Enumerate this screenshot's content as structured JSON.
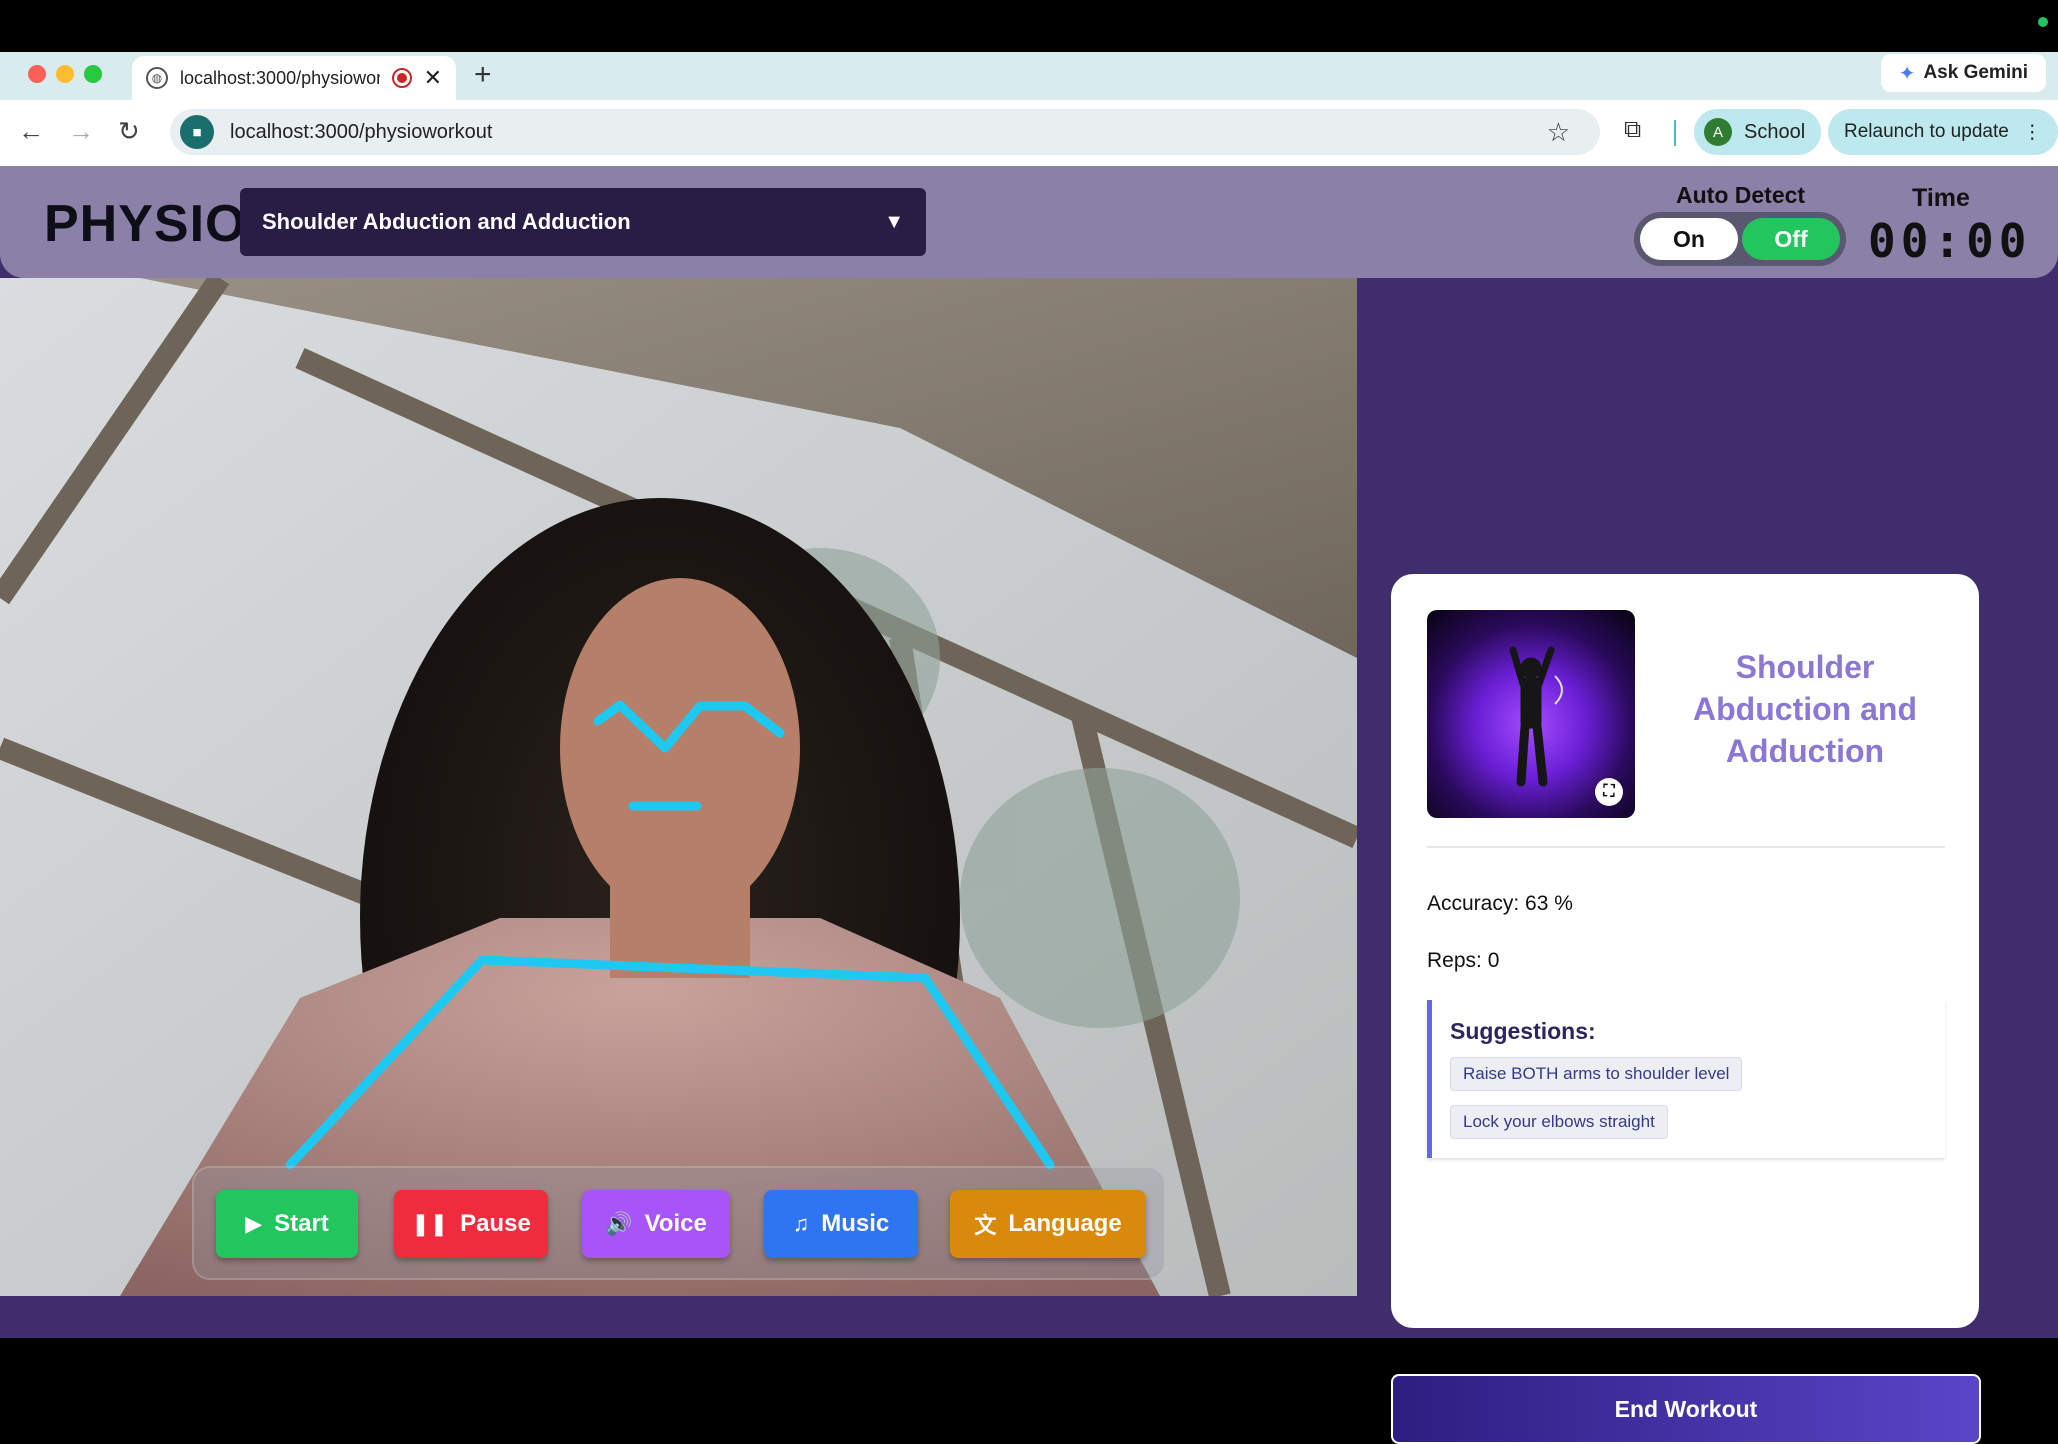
{
  "browser": {
    "tab_title": "localhost:3000/physiowor",
    "new_tab": "+",
    "ask_gemini": "Ask Gemini",
    "url": "localhost:3000/physioworkout",
    "profile_initial": "A",
    "profile_name": "School",
    "relaunch_label": "Relaunch to update"
  },
  "header": {
    "logo": "PHYSIO",
    "exercise_selected": "Shoulder Abduction and Adduction",
    "auto_detect_label": "Auto Detect",
    "toggle_on": "On",
    "toggle_off": "Off",
    "toggle_state": "Off",
    "time_label": "Time",
    "time_value": "00:00"
  },
  "controls": {
    "start": "Start",
    "pause": "Pause",
    "voice": "Voice",
    "music": "Music",
    "language": "Language"
  },
  "panel": {
    "title": "Shoulder Abduction and Adduction",
    "accuracy": "Accuracy: 63 %",
    "reps": "Reps: 0",
    "suggestions_title": "Suggestions:",
    "suggestions": [
      "Raise BOTH arms to shoulder level",
      "Lock your elbows straight"
    ],
    "end_workout": "End Workout"
  },
  "colors": {
    "app_bg": "#3f2e6b",
    "header_bg": "#8a80a8",
    "pose_line": "#1ec8f0",
    "accent_title": "#8b78d6"
  },
  "icons": {
    "start": "play-icon",
    "pause": "pause-icon",
    "voice": "speaker-icon",
    "music": "music-note-icon",
    "language": "translate-icon"
  }
}
